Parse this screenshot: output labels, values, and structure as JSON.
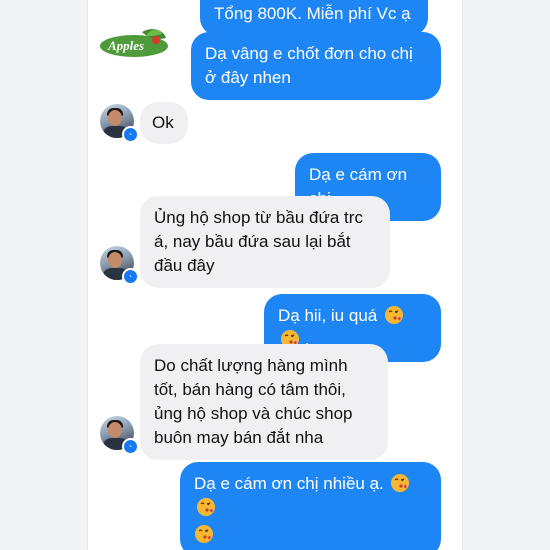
{
  "conversation": {
    "messages": [
      {
        "id": "m1",
        "side": "out",
        "text": "Tổng 800K. Miễn phí Vc ạ"
      },
      {
        "id": "m2",
        "side": "out",
        "text": "Dạ vâng e chốt đơn cho chị ở đây nhen"
      },
      {
        "id": "m3",
        "side": "in",
        "text": "Ok"
      },
      {
        "id": "m4",
        "side": "out",
        "text": "Dạ e cám ơn chị"
      },
      {
        "id": "m5",
        "side": "in",
        "text": "Ủng hộ shop từ bầu đứa trc á, nay bầu đứa sau lại bắt đầu đây"
      },
      {
        "id": "m6",
        "side": "out",
        "text": "Dạ hii, iu quá",
        "suffix": "."
      },
      {
        "id": "m7",
        "side": "in",
        "text": "Do chất lượng hàng mình tốt, bán hàng có tâm thôi, ủng hộ shop và chúc shop buôn may bán đắt nha"
      },
      {
        "id": "m8",
        "side": "out",
        "text": "Dạ e cám ơn chị nhiều ạ."
      }
    ]
  },
  "shop_logo": {
    "text": "Apples",
    "icon": "apple-leaf-logo"
  },
  "emoji": {
    "name": "face-blowing-kiss",
    "color": "#f7b733"
  },
  "colors": {
    "outgoing_bubble": "#1e86f4",
    "incoming_bubble": "#f0f0f2",
    "messenger_badge": "#1877f2"
  }
}
